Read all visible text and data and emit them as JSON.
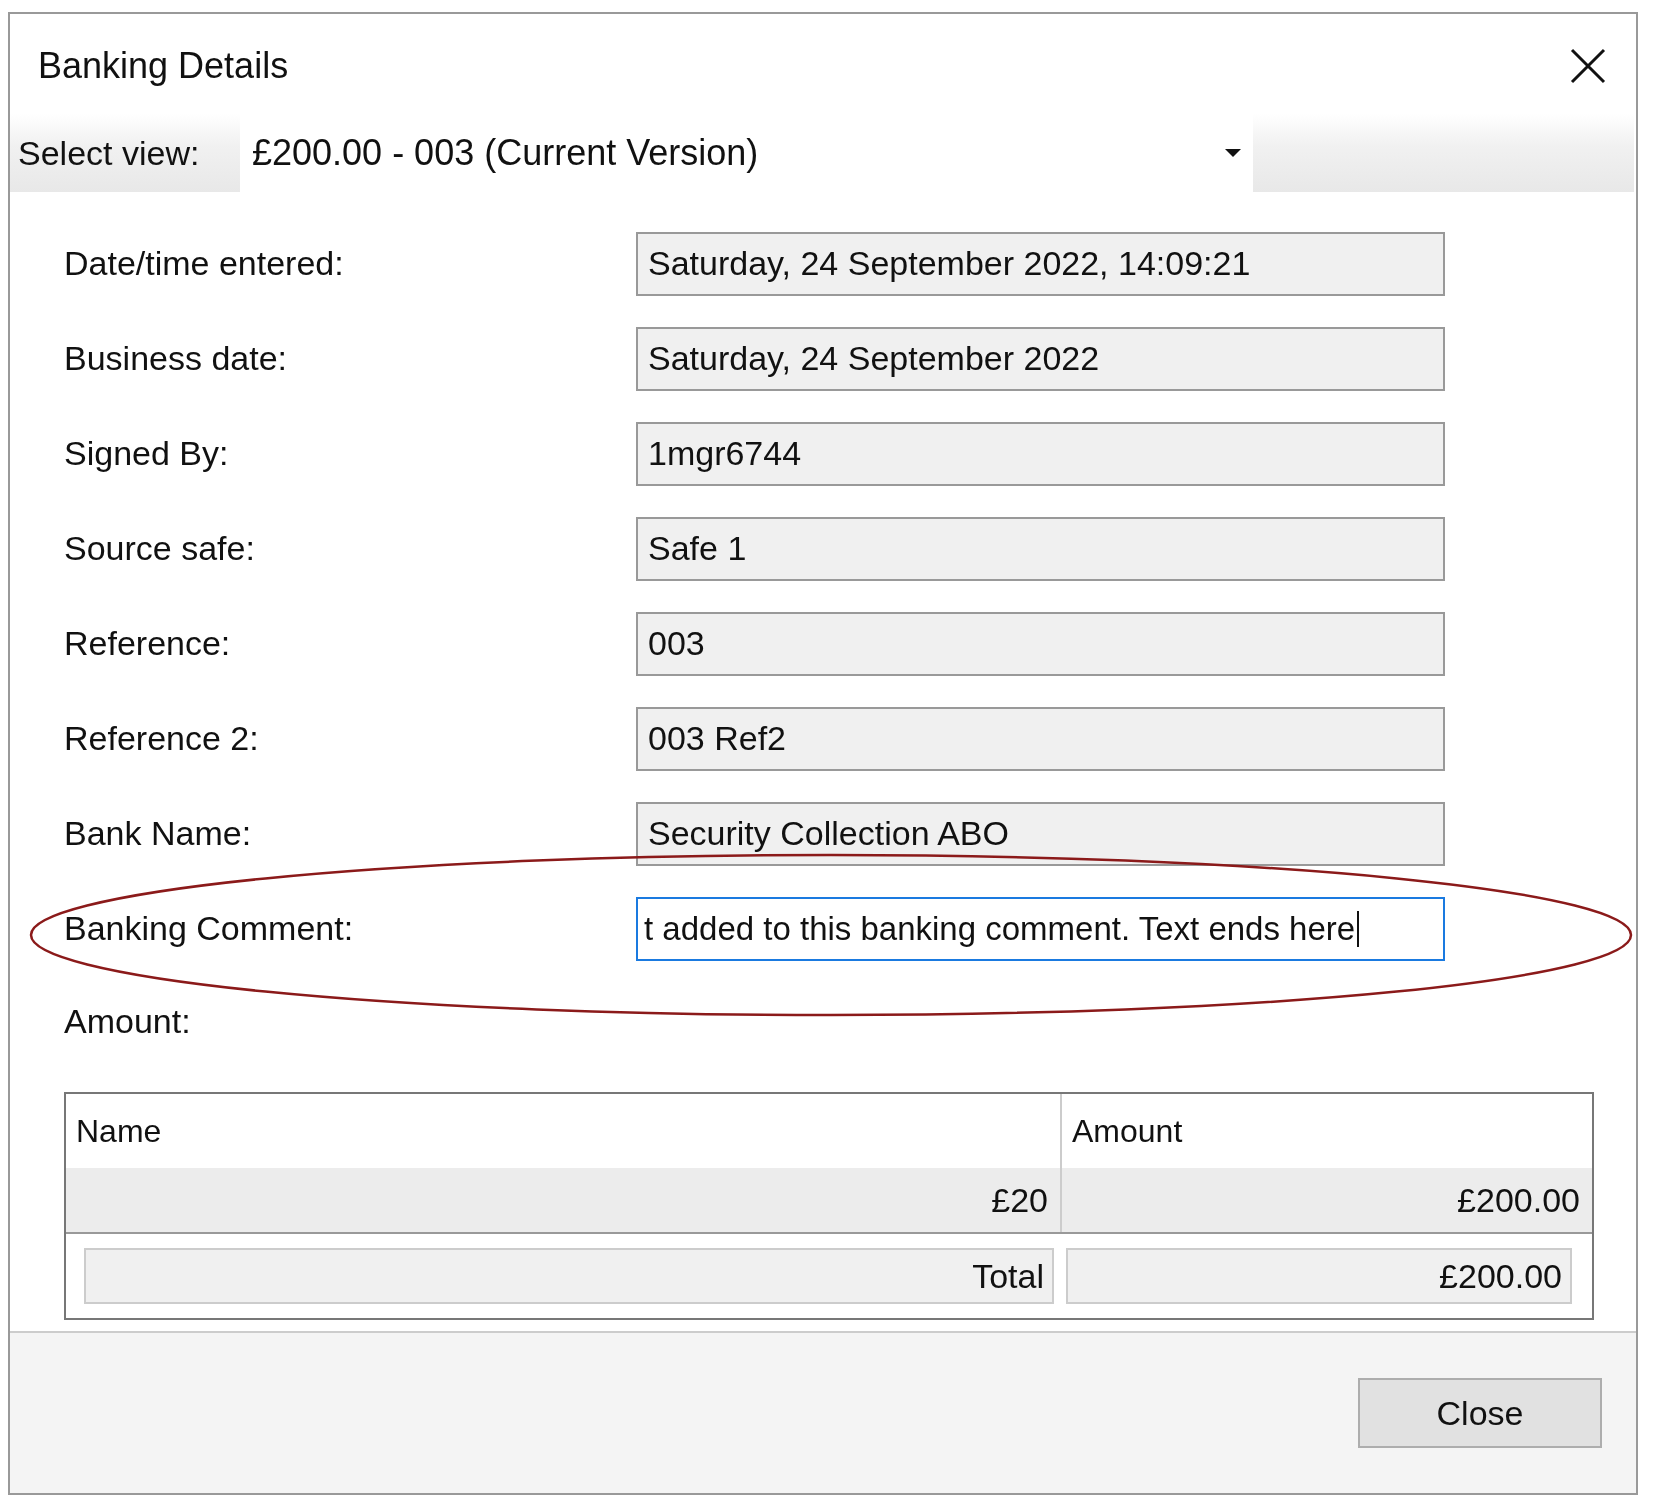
{
  "window": {
    "title": "Banking Details"
  },
  "select_view": {
    "label": "Select view:",
    "value": "£200.00 - 003 (Current Version)"
  },
  "fields": [
    {
      "label": "Date/time entered:",
      "value": "Saturday, 24 September 2022, 14:09:21",
      "focused": false
    },
    {
      "label": "Business date:",
      "value": "Saturday, 24 September 2022",
      "focused": false
    },
    {
      "label": "Signed By:",
      "value": "1mgr6744",
      "focused": false
    },
    {
      "label": "Source safe:",
      "value": "Safe 1",
      "focused": false
    },
    {
      "label": "Reference:",
      "value": "003",
      "focused": false
    },
    {
      "label": "Reference 2:",
      "value": "003 Ref2",
      "focused": false
    },
    {
      "label": "Bank Name:",
      "value": "Security Collection ABO",
      "focused": false
    },
    {
      "label": "Banking Comment:",
      "value": "t added to this banking comment. Text ends here",
      "focused": true
    }
  ],
  "amount_label": "Amount:",
  "table": {
    "columns": [
      "Name",
      "Amount"
    ],
    "rows": [
      [
        "£20",
        "£200.00"
      ]
    ],
    "total": [
      "Total",
      "£200.00"
    ]
  },
  "buttons": [
    "Close"
  ]
}
